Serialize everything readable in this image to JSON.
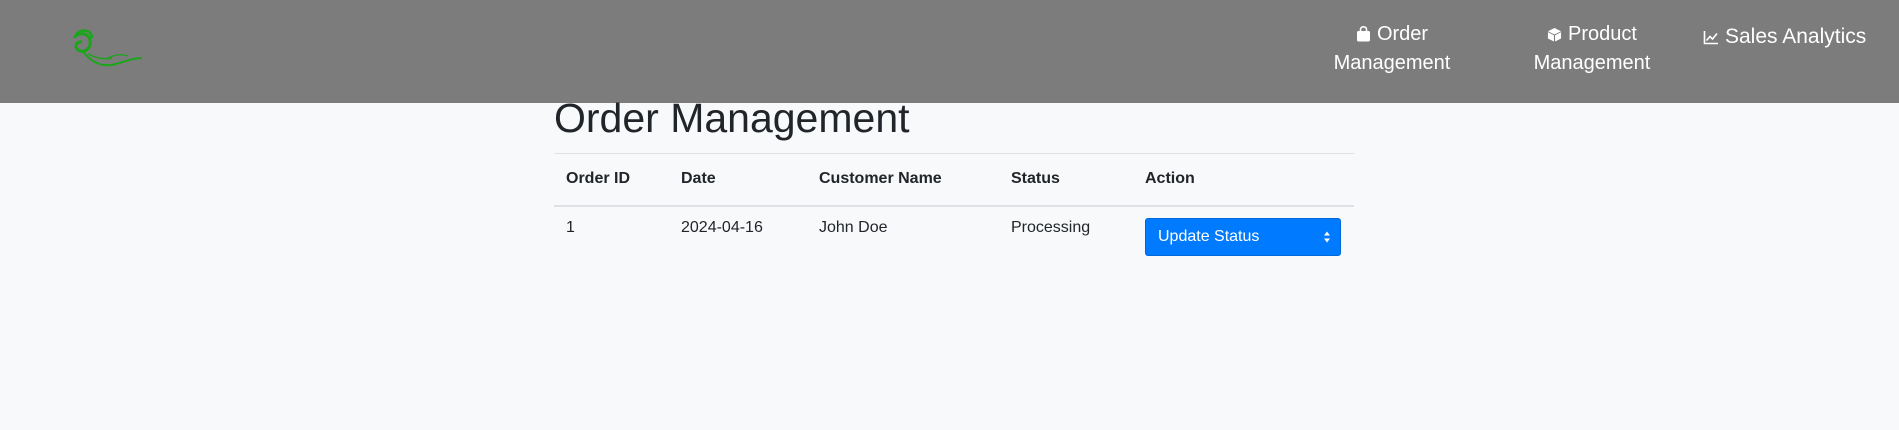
{
  "header": {
    "logo_name": "leaf-logo",
    "nav": [
      {
        "icon": "shopping-bag-icon",
        "label": "Order Management"
      },
      {
        "icon": "box-icon",
        "label": "Product Management"
      },
      {
        "icon": "line-chart-icon",
        "label": "Sales Analytics"
      }
    ]
  },
  "main": {
    "title": "Order Management",
    "columns": [
      "Order ID",
      "Date",
      "Customer Name",
      "Status",
      "Action"
    ],
    "rows": [
      {
        "order_id": "1",
        "date": "2024-04-16",
        "customer": "John Doe",
        "status": "Processing",
        "action_label": "Update Status"
      }
    ]
  },
  "colors": {
    "header_bg": "#7c7c7c",
    "accent": "#007bff",
    "logo": "#1aa51a",
    "page_bg": "#f8f9fa"
  }
}
